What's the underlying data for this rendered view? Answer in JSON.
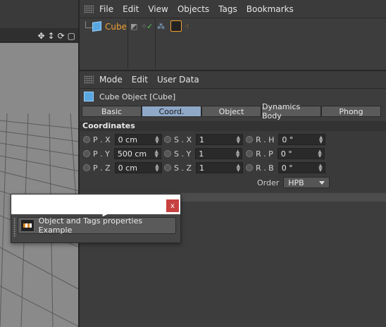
{
  "object_manager": {
    "menu": [
      "File",
      "Edit",
      "View",
      "Objects",
      "Tags",
      "Bookmarks"
    ],
    "object_name": "Cube"
  },
  "attribute_manager": {
    "menu": [
      "Mode",
      "Edit",
      "User Data"
    ],
    "object_title": "Cube Object [Cube]",
    "tabs": [
      {
        "label": "Basic",
        "active": false
      },
      {
        "label": "Coord.",
        "active": true
      },
      {
        "label": "Object",
        "active": false
      },
      {
        "label": "Dynamics Body",
        "active": false
      },
      {
        "label": "Phong",
        "active": false
      }
    ],
    "section_title": "Coordinates",
    "fields": {
      "px_label": "P . X",
      "px_value": "0 cm",
      "py_label": "P . Y",
      "py_value": "500 cm",
      "pz_label": "P . Z",
      "pz_value": "0 cm",
      "sx_label": "S . X",
      "sx_value": "1",
      "sy_label": "S . Y",
      "sy_value": "1",
      "sz_label": "S . Z",
      "sz_value": "1",
      "rh_label": "R . H",
      "rh_value": "0 °",
      "rp_label": "R . P",
      "rp_value": "0 °",
      "rb_label": "R . B",
      "rb_value": "0 °"
    },
    "order_label": "Order",
    "order_value": "HPB"
  },
  "dialog": {
    "close_label": "x",
    "button_label": "Object and Tags properties Example"
  },
  "icons": {
    "viewport": [
      "move-icon",
      "pan-icon",
      "rotate-icon",
      "maximize-icon"
    ]
  },
  "colors": {
    "active_tab": "#8fa8c8",
    "object_name": "#f0a030",
    "close_button": "#c74141"
  }
}
